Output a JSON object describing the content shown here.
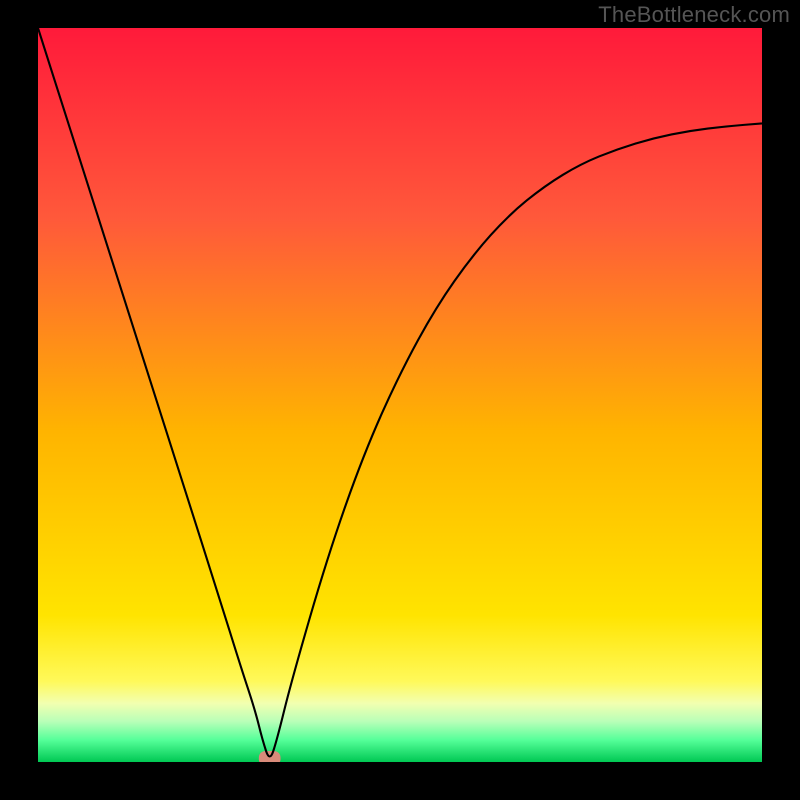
{
  "attribution": "TheBottleneck.com",
  "chart_data": {
    "type": "line",
    "title": "",
    "xlabel": "",
    "ylabel": "",
    "xlim": [
      0,
      100
    ],
    "ylim": [
      0,
      100
    ],
    "background_gradient": {
      "top": "#ff1a3a",
      "mid": "#ffd400",
      "bottom_band_1": "#f7ff6a",
      "bottom_band_2": "#66ff99",
      "bottom": "#00c853"
    },
    "series": [
      {
        "name": "bottleneck-curve",
        "color": "#000000",
        "x": [
          0,
          5,
          10,
          15,
          20,
          25,
          28,
          30,
          31,
          32,
          33,
          35,
          40,
          45,
          50,
          55,
          60,
          65,
          70,
          75,
          80,
          85,
          90,
          95,
          100
        ],
        "y": [
          100,
          84.5,
          69,
          53.5,
          38,
          22.5,
          13,
          7,
          3,
          0,
          3,
          11,
          28,
          42,
          53,
          62,
          69,
          74.5,
          78.5,
          81.5,
          83.5,
          85,
          86,
          86.6,
          87
        ]
      }
    ],
    "marker": {
      "x": 32,
      "y": 0.5,
      "color": "#d98b7a",
      "width": 3.0,
      "height": 2.0,
      "shape": "rounded-rect"
    }
  }
}
